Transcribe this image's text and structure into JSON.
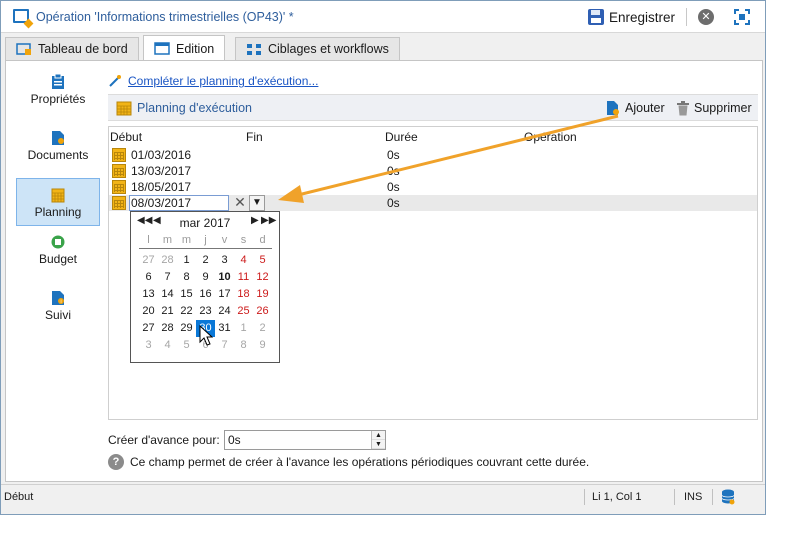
{
  "window": {
    "title": "Opération 'Informations trimestrielles (OP43)' *",
    "save_label": "Enregistrer"
  },
  "tabs": [
    {
      "label": "Tableau de bord"
    },
    {
      "label": "Edition"
    },
    {
      "label": "Ciblages et workflows"
    }
  ],
  "sidebar": {
    "items": [
      {
        "label": "Propriétés"
      },
      {
        "label": "Documents"
      },
      {
        "label": "Planning"
      },
      {
        "label": "Budget"
      },
      {
        "label": "Suivi"
      }
    ]
  },
  "main": {
    "complete_link": "Compléter le planning d'exécution...",
    "toolbar_title": "Planning d'exécution",
    "add_label": "Ajouter",
    "delete_label": "Supprimer",
    "columns": [
      "Début",
      "Fin",
      "Durée",
      "Opération"
    ],
    "rows": [
      {
        "start": "01/03/2016",
        "duration": "0s"
      },
      {
        "start": "13/03/2017",
        "duration": "0s"
      },
      {
        "start": "18/05/2017",
        "duration": "0s"
      }
    ],
    "editing_row": {
      "start": "08/03/2017",
      "duration": "0s"
    },
    "calendar": {
      "month_label": "mar 2017",
      "nav_prev_year": "◀◀",
      "nav_prev_month": "◀",
      "nav_next_month": "▶",
      "nav_next_year": "▶▶",
      "weekdays": [
        "l",
        "m",
        "m",
        "j",
        "v",
        "s",
        "d"
      ],
      "weeks": [
        [
          "27",
          "28",
          "1",
          "2",
          "3",
          "4",
          "5"
        ],
        [
          "6",
          "7",
          "8",
          "9",
          "10",
          "11",
          "12"
        ],
        [
          "13",
          "14",
          "15",
          "16",
          "17",
          "18",
          "19"
        ],
        [
          "20",
          "21",
          "22",
          "23",
          "24",
          "25",
          "26"
        ],
        [
          "27",
          "28",
          "29",
          "30",
          "31",
          "1",
          "2"
        ],
        [
          "3",
          "4",
          "5",
          "6",
          "7",
          "8",
          "9"
        ]
      ],
      "selected": "30",
      "today": "10"
    },
    "advance_label": "Créer d'avance pour:",
    "advance_value": "0s",
    "help_text": "Ce champ permet de créer à l'avance les opérations périodiques couvrant cette durée."
  },
  "status": {
    "left": "Début",
    "position": "Li 1, Col 1",
    "mode": "INS"
  },
  "colors": {
    "accent": "#1a55c4",
    "selection": "#0a78d7",
    "arrow": "#f0a22a",
    "weekend": "#cc1a1a"
  }
}
